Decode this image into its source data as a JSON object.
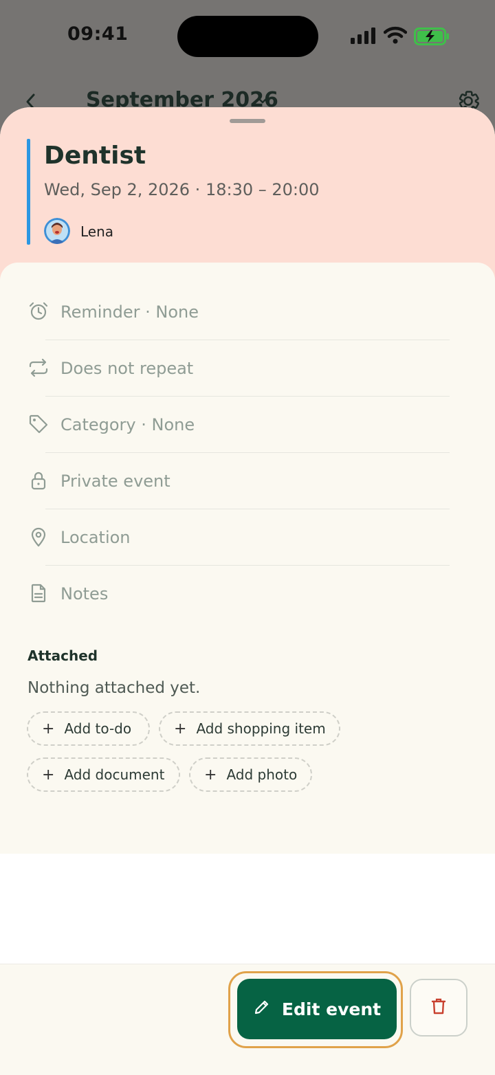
{
  "status_bar": {
    "time": "09:41",
    "icons": [
      "signal-icon",
      "wifi-icon",
      "battery-charging-icon"
    ],
    "battery_color": "#3fbf4a"
  },
  "background_header": {
    "month_title": "September 2026",
    "icons": [
      "chevron-left-icon",
      "chevron-down-icon",
      "gear-icon"
    ]
  },
  "event": {
    "title": "Dentist",
    "datetime": "Wed, Sep 2, 2026 · 18:30 – 20:00",
    "attendee": "Lena",
    "accent_color": "#2b97e2",
    "header_color": "#fdddd3"
  },
  "details": [
    {
      "icon": "alarm-clock-icon",
      "label": "Reminder · None"
    },
    {
      "icon": "repeat-icon",
      "label": "Does not repeat"
    },
    {
      "icon": "tag-icon",
      "label": "Category · None"
    },
    {
      "icon": "lock-icon",
      "label": "Private event"
    },
    {
      "icon": "location-pin-icon",
      "label": "Location"
    },
    {
      "icon": "document-icon",
      "label": "Notes"
    }
  ],
  "attached": {
    "title": "Attached",
    "empty_text": "Nothing attached yet.",
    "chips": [
      "Add to-do",
      "Add shopping item",
      "Add document",
      "Add photo"
    ]
  },
  "actions": {
    "edit_label": "Edit event",
    "primary_color": "#066344",
    "focus_ring_color": "#e0a24a",
    "delete_icon": "trash-icon",
    "delete_color": "#c8412f"
  }
}
